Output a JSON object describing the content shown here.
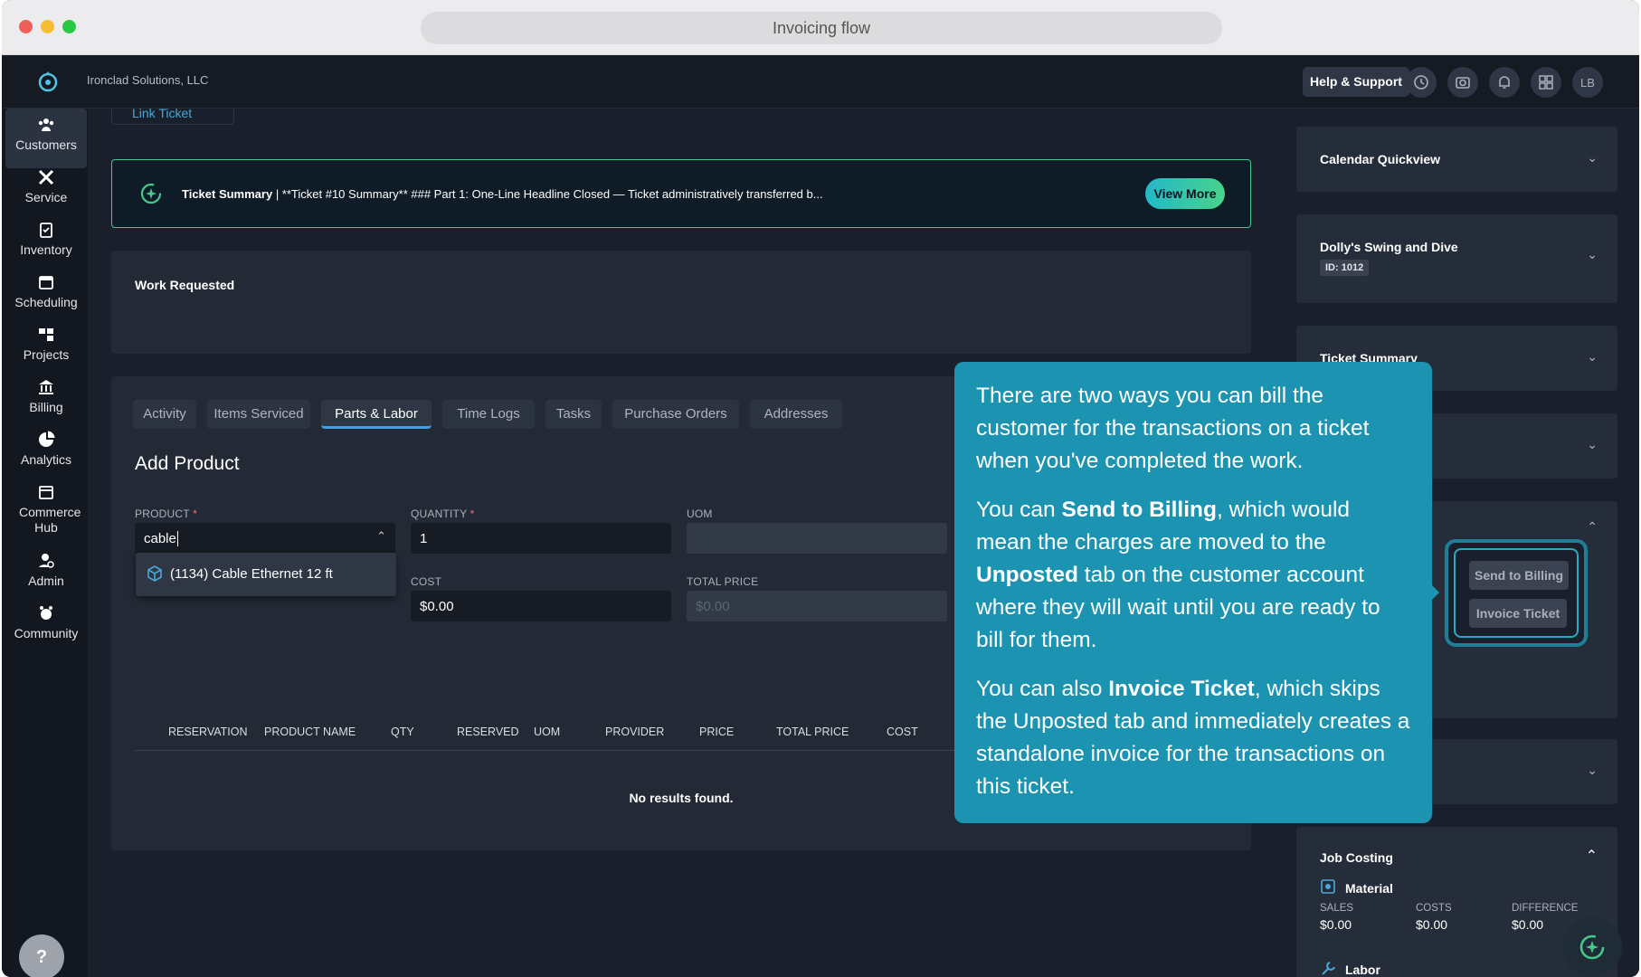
{
  "window": {
    "url_title": "Invoicing flow"
  },
  "header": {
    "company": "Ironclad Solutions, LLC",
    "help_label": "Help & Support",
    "avatar": "LB",
    "icons": [
      "history-icon",
      "camera-icon",
      "bell-icon",
      "apps-icon"
    ]
  },
  "sidebar": {
    "items": [
      {
        "label": "Customers",
        "icon": "customers-icon",
        "active": true
      },
      {
        "label": "Service",
        "icon": "tools-icon"
      },
      {
        "label": "Inventory",
        "icon": "clipboard-icon"
      },
      {
        "label": "Scheduling",
        "icon": "calendar-icon"
      },
      {
        "label": "Projects",
        "icon": "projects-icon"
      },
      {
        "label": "Billing",
        "icon": "bank-icon"
      },
      {
        "label": "Analytics",
        "icon": "pie-icon"
      },
      {
        "label": "Commerce Hub",
        "icon": "store-icon"
      },
      {
        "label": "Admin",
        "icon": "admin-icon"
      },
      {
        "label": "Community",
        "icon": "community-icon"
      }
    ],
    "help": "?"
  },
  "main": {
    "link_ticket": "Link Ticket",
    "summary": {
      "label": "Ticket Summary",
      "text": " | **Ticket #10 Summary** ### Part 1: One-Line Headline Closed — Ticket administratively transferred b...",
      "button": "View More"
    },
    "work_requested": "Work Requested",
    "tabs": [
      "Activity",
      "Items Serviced",
      "Parts & Labor",
      "Time Logs",
      "Tasks",
      "Purchase Orders",
      "Addresses"
    ],
    "active_tab": "Parts & Labor",
    "add_product": {
      "title": "Add Product",
      "product_label": "PRODUCT",
      "product_value": "cable",
      "quantity_label": "QUANTITY",
      "quantity_value": "1",
      "uom_label": "UOM",
      "uom_value": "",
      "cost_label": "COST",
      "cost_value": "$0.00",
      "total_label": "TOTAL PRICE",
      "total_value": "$0.00",
      "dropdown_option": "(1134) Cable Ethernet 12 ft"
    },
    "table": {
      "columns": [
        "RESERVATION",
        "PRODUCT NAME",
        "QTY",
        "RESERVED",
        "UOM",
        "PROVIDER",
        "PRICE",
        "TOTAL PRICE",
        "COST"
      ],
      "empty": "No results found."
    }
  },
  "right_panel": {
    "calendar": "Calendar Quickview",
    "customer": "Dolly's Swing and Dive",
    "customer_id": "ID: 1012",
    "ticket_summary": "Ticket Summary",
    "send_to_billing": "Send to Billing",
    "invoice_ticket": "Invoice Ticket",
    "job_costing": {
      "title": "Job Costing",
      "material": "Material",
      "sales_label": "SALES",
      "costs_label": "COSTS",
      "diff_label": "DIFFERENCE",
      "sales": "$0.00",
      "costs": "$0.00",
      "difference": "$0.00",
      "labor": "Labor"
    }
  },
  "tooltip": {
    "p1": "There are two ways you can bill the customer for the transactions on a ticket when you've completed the work.",
    "p2_a": "You can ",
    "p2_b": "Send to Billing",
    "p2_c": ", which would mean the charges are moved to the ",
    "p2_d": "Unposted",
    "p2_e": " tab on the customer account where they will wait until you are ready to bill for them.",
    "p3_a": "You can also ",
    "p3_b": "Invoice Ticket",
    "p3_c": ", which skips the Unposted tab and immediately creates a standalone invoice for the transactions on this ticket."
  },
  "colors": {
    "accent": "#3f9fe0",
    "tooltip": "#1d93b2",
    "banner_border": "#47c98e"
  }
}
